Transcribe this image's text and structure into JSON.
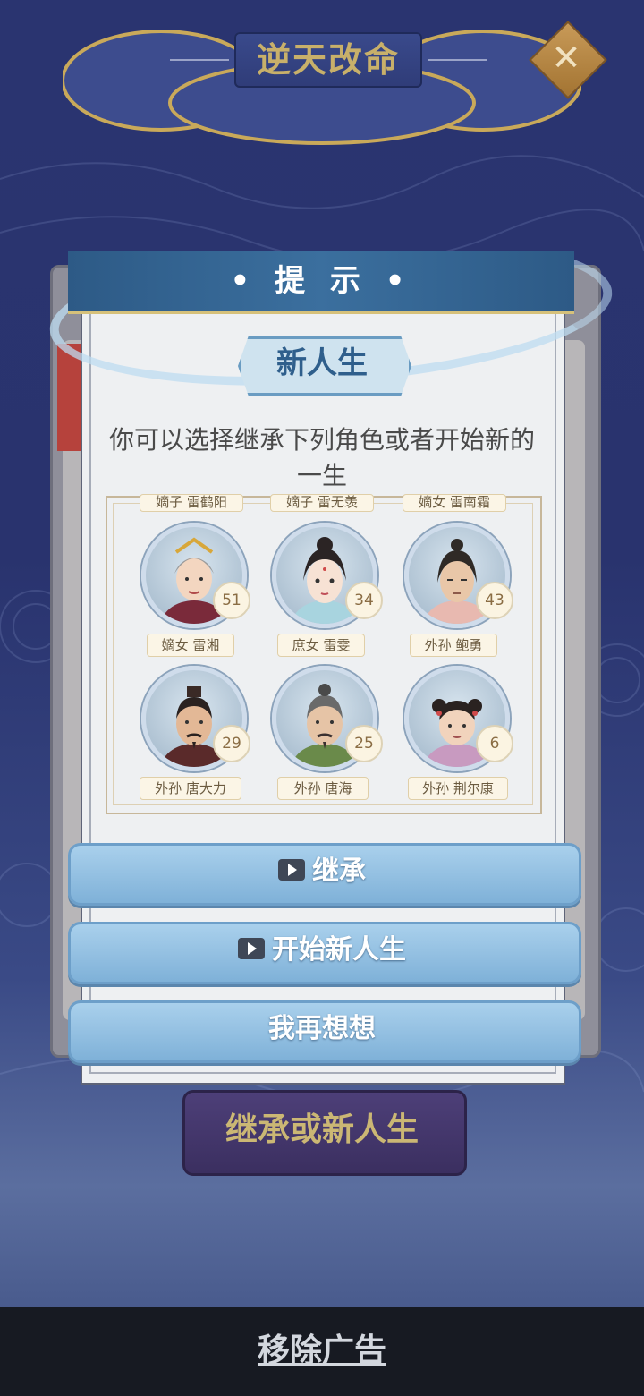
{
  "top": {
    "title": "逆天改命",
    "close_icon": "close-icon"
  },
  "dialog": {
    "header": "• 提 示 •",
    "tag": "新人生",
    "description": "你可以选择继承下列角色或者开始新的一生"
  },
  "partial_row": [
    "嫡子 雷鹤阳",
    "嫡子 雷无羡",
    "嫡女 雷南霜"
  ],
  "characters": [
    {
      "name": "嫡女 雷湘",
      "age": "51"
    },
    {
      "name": "庶女 雷雯",
      "age": "34"
    },
    {
      "name": "外孙 鲍勇",
      "age": "43"
    },
    {
      "name": "外孙 唐大力",
      "age": "29"
    },
    {
      "name": "外孙 唐海",
      "age": "25"
    },
    {
      "name": "外孙 荆尔康",
      "age": "6"
    }
  ],
  "buttons": {
    "inherit": "继承",
    "new_life": "开始新人生",
    "think": "我再想想"
  },
  "bottom_button": "继承或新人生",
  "ad": "移除广告",
  "colors": {
    "accent": "#2f5f8c",
    "button": "#8fbfe0",
    "gold": "#c8b06a"
  }
}
